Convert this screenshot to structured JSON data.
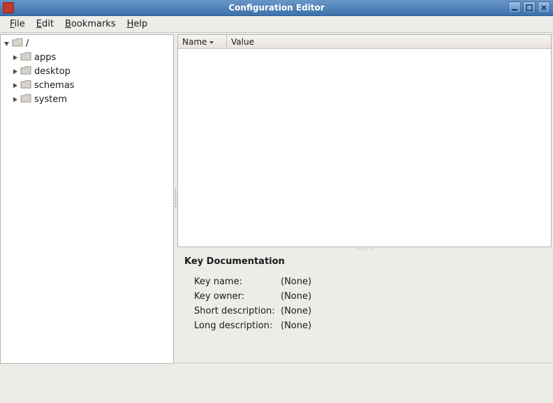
{
  "window": {
    "title": "Configuration Editor"
  },
  "menubar": [
    {
      "label": "File",
      "accel": "F"
    },
    {
      "label": "Edit",
      "accel": "E"
    },
    {
      "label": "Bookmarks",
      "accel": "B"
    },
    {
      "label": "Help",
      "accel": "H"
    }
  ],
  "tree": {
    "root": {
      "label": "/",
      "expanded": true
    },
    "children": [
      {
        "label": "apps",
        "expanded": false
      },
      {
        "label": "desktop",
        "expanded": false
      },
      {
        "label": "schemas",
        "expanded": false
      },
      {
        "label": "system",
        "expanded": false
      }
    ]
  },
  "table": {
    "columns": {
      "name": "Name",
      "value": "Value"
    },
    "sort_column": "name",
    "sort_dir": "asc",
    "rows": []
  },
  "doc": {
    "heading": "Key Documentation",
    "key_name_label": "Key name:",
    "key_name_value": "(None)",
    "key_owner_label": "Key owner:",
    "key_owner_value": "(None)",
    "short_desc_label": "Short description:",
    "short_desc_value": "(None)",
    "long_desc_label": "Long description:",
    "long_desc_value": "(None)"
  }
}
